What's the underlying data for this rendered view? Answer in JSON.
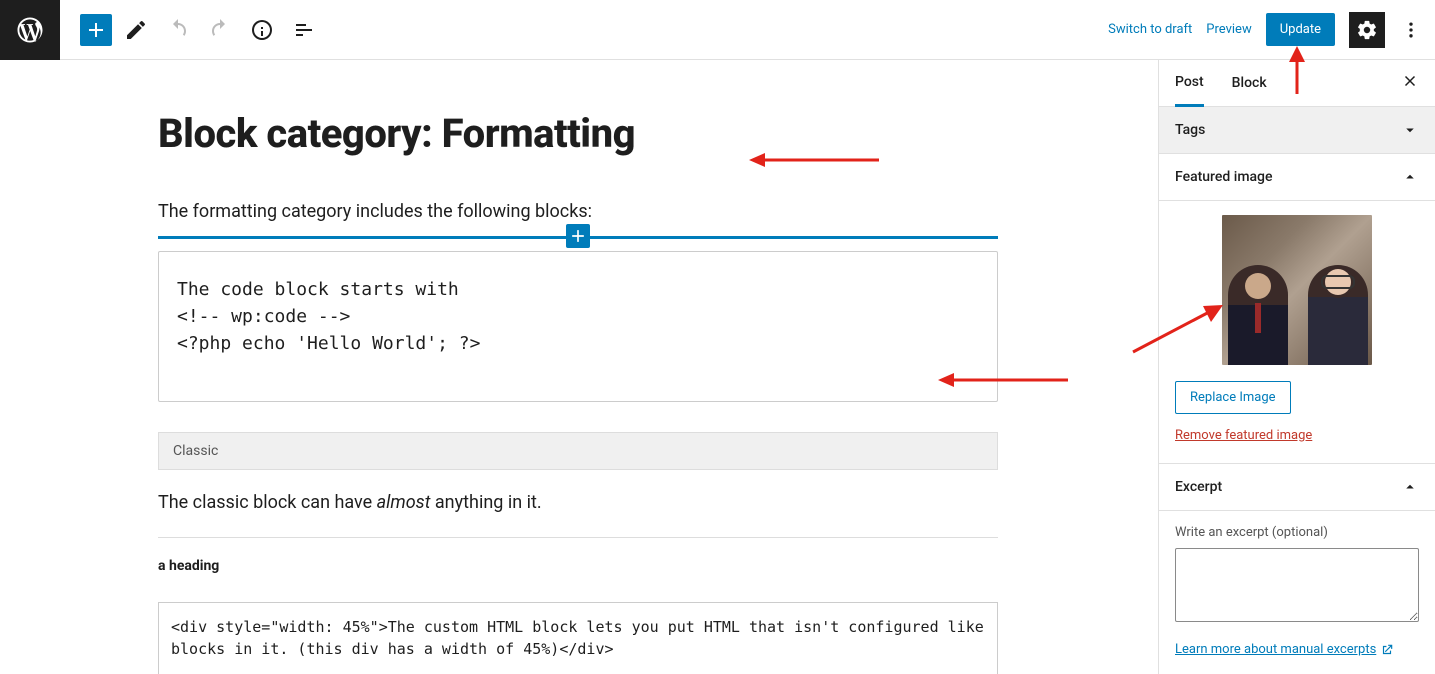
{
  "header": {
    "switch_to_draft": "Switch to draft",
    "preview": "Preview",
    "update": "Update"
  },
  "editor": {
    "title": "Block category: Formatting",
    "intro": "The formatting category includes the following blocks:",
    "code_block": "The code block starts with\n<!-- wp:code -->\n<?php echo 'Hello World'; ?>",
    "classic_label": "Classic",
    "classic_text_1": "The classic block can have ",
    "classic_text_em": "almost",
    "classic_text_2": " anything in it.",
    "heading": "a heading",
    "html_block": "<div style=\"width: 45%\">The custom HTML block lets you put HTML that isn't configured like blocks in it. (this div has a width of 45%)</div>"
  },
  "sidebar": {
    "tab_post": "Post",
    "tab_block": "Block",
    "panel_tags": "Tags",
    "panel_featured": "Featured image",
    "replace_image": "Replace Image",
    "remove_featured": "Remove featured image",
    "panel_excerpt": "Excerpt",
    "excerpt_label": "Write an excerpt (optional)",
    "learn_more": "Learn more about manual excerpts"
  }
}
